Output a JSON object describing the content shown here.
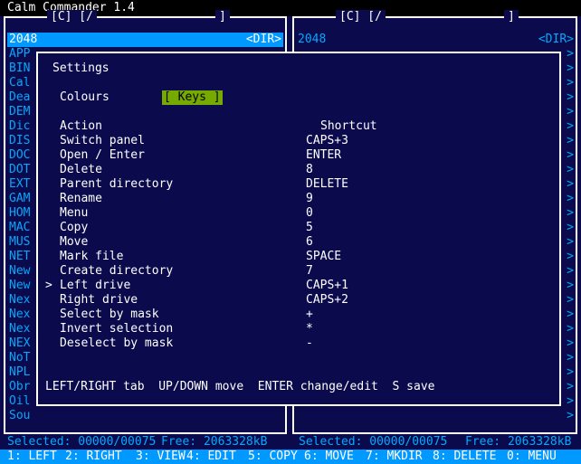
{
  "app": {
    "title": "Calm Commander 1.4"
  },
  "left_panel": {
    "path": "[C] [/",
    "path_end": "]",
    "selected_name": "2048",
    "selected_type": "<DIR>",
    "items": [
      "APP",
      "BIN",
      "Cal",
      "Dea",
      "DEM",
      "Dic",
      "DIS",
      "DOC",
      "DOT",
      "EXT",
      "GAM",
      "HOM",
      "MAC",
      "MUS",
      "NET",
      "New",
      "New",
      "Nex",
      "Nex",
      "Nex",
      "NEX",
      "NoT",
      "NPL",
      "Obr",
      "Oil",
      "Sou"
    ]
  },
  "right_panel": {
    "path": "[C] [/",
    "path_end": "]",
    "selected_name": "2048",
    "selected_type": "<DIR>"
  },
  "dialog": {
    "title": "Settings",
    "colours_label": "Colours",
    "keys_tab": "[ Keys ]",
    "action_header": "Action",
    "shortcut_header": "Shortcut",
    "cursor": ">",
    "rows": [
      {
        "action": "Switch panel",
        "shortcut": "CAPS+3"
      },
      {
        "action": "Open / Enter",
        "shortcut": "ENTER"
      },
      {
        "action": "Delete",
        "shortcut": "8"
      },
      {
        "action": "Parent directory",
        "shortcut": "DELETE"
      },
      {
        "action": "Rename",
        "shortcut": "9"
      },
      {
        "action": "Menu",
        "shortcut": "0"
      },
      {
        "action": "Copy",
        "shortcut": "5"
      },
      {
        "action": "Move",
        "shortcut": "6"
      },
      {
        "action": "Mark file",
        "shortcut": "SPACE"
      },
      {
        "action": "Create directory",
        "shortcut": "7"
      },
      {
        "action": "Left drive",
        "shortcut": "CAPS+1"
      },
      {
        "action": "Right drive",
        "shortcut": "CAPS+2"
      },
      {
        "action": "Select by mask",
        "shortcut": "+"
      },
      {
        "action": "Invert selection",
        "shortcut": "*"
      },
      {
        "action": "Deselect by mask",
        "shortcut": "-"
      }
    ],
    "help": "LEFT/RIGHT tab  UP/DOWN move  ENTER change/edit  S save"
  },
  "status": {
    "left_selected": "Selected: 00000/00075",
    "left_free": "Free: 2063328kB",
    "right_selected": "Selected: 00000/00075",
    "right_free": "Free: 2063328kB"
  },
  "fkeys": [
    {
      "num": "1:",
      "label": "LEFT"
    },
    {
      "num": "2:",
      "label": "RIGHT"
    },
    {
      "num": "3:",
      "label": "VIEW"
    },
    {
      "num": "4:",
      "label": "EDIT"
    },
    {
      "num": "5:",
      "label": "COPY"
    },
    {
      "num": "6:",
      "label": "MOVE"
    },
    {
      "num": "7:",
      "label": "MKDIR"
    },
    {
      "num": "8:",
      "label": "DELETE"
    },
    {
      "num": "0:",
      "label": "MENU"
    }
  ]
}
